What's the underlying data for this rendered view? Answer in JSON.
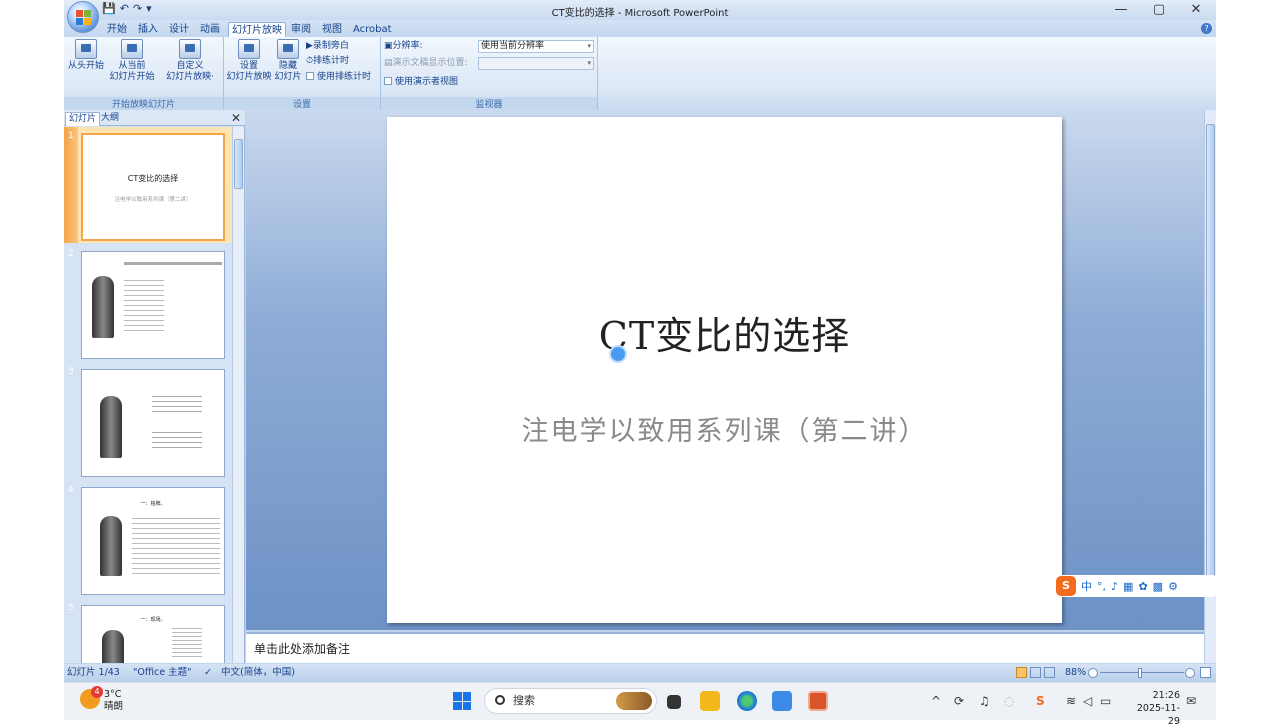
{
  "window": {
    "title": "CT变比的选择 - Microsoft PowerPoint",
    "minimize": "—",
    "restore": "▢",
    "close": "✕"
  },
  "qat": {
    "save": "💾",
    "undo": "↶",
    "redo": "↷",
    "more": "▾"
  },
  "ribbon_tabs": [
    {
      "label": "开始"
    },
    {
      "label": "插入"
    },
    {
      "label": "设计"
    },
    {
      "label": "动画"
    },
    {
      "label": "幻灯片放映",
      "active": true
    },
    {
      "label": "审阅"
    },
    {
      "label": "视图"
    },
    {
      "label": "Acrobat"
    }
  ],
  "ribbon": {
    "group_start": {
      "label": "开始放映幻灯片",
      "from_beginning": "从头开始",
      "from_current_1": "从当前",
      "from_current_2": "幻灯片开始",
      "custom_1": "自定义",
      "custom_2": "幻灯片放映·"
    },
    "group_setup": {
      "label": "设置",
      "setup_1": "设置",
      "setup_2": "幻灯片放映",
      "hide_1": "隐藏",
      "hide_2": "幻灯片",
      "record_narration": "录制旁白",
      "rehearse_timings": "排练计时",
      "use_rehearsed": "使用排练计时"
    },
    "group_monitors": {
      "label": "监视器",
      "resolution_label": "分辨率:",
      "resolution_value": "使用当前分辨率",
      "show_on_label": "演示文稿显示位置:",
      "show_on_value": "",
      "presenter_view": "使用演示者视图"
    }
  },
  "pane": {
    "tab_slides": "幻灯片",
    "tab_outline": "大纲",
    "close": "✕",
    "thumbnails": [
      {
        "num": "1",
        "title": "CT变比的选择",
        "sub": "注电学以致用系列课（第二讲）"
      },
      {
        "num": "2",
        "title": "",
        "sub": ""
      },
      {
        "num": "3",
        "title": "",
        "sub": ""
      },
      {
        "num": "4",
        "title": "一：铭牌。",
        "sub": ""
      },
      {
        "num": "5",
        "title": "一：现场。",
        "sub": ""
      }
    ]
  },
  "slide": {
    "title": "CT变比的选择",
    "subtitle": "注电学以致用系列课（第二讲）"
  },
  "notes": {
    "placeholder": "单击此处添加备注"
  },
  "status": {
    "slide_info": "幻灯片 1/43",
    "theme": "\"Office 主题\"",
    "language": "中文(简体，中国)",
    "zoom": "88%"
  },
  "ime": {
    "logo": "S",
    "mode": "中",
    "punct": "°,"
  },
  "taskbar": {
    "weather_temp": "3°C",
    "weather_desc": "晴朗",
    "weather_badge": "4",
    "search_placeholder": "搜索",
    "time": "21:26",
    "date": "2025-11-29"
  }
}
